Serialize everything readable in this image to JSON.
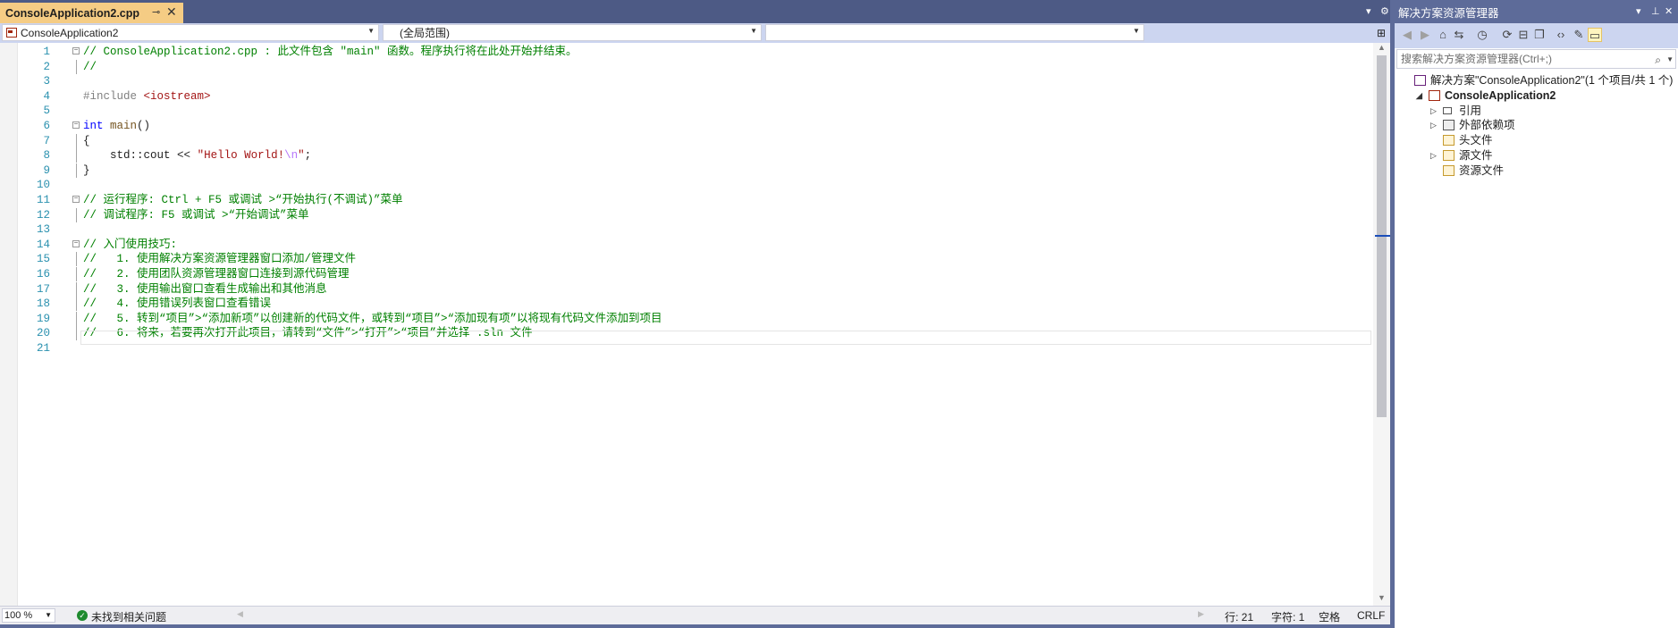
{
  "editor": {
    "tab": {
      "title": "ConsoleApplication2.cpp",
      "pin_glyph": "⊸",
      "close_glyph": "✕"
    },
    "navbar": {
      "project_combo": "ConsoleApplication2",
      "scope_combo": "(全局范围)",
      "member_combo": ""
    },
    "lines": [
      {
        "n": "1",
        "parts": [
          {
            "t": "// ConsoleApplication2.cpp : 此文件包含 \"main\" 函数。程序执行将在此处开始并结束。",
            "c": "cmt"
          }
        ],
        "fold": "−"
      },
      {
        "n": "2",
        "parts": [
          {
            "t": "//",
            "c": "cmt"
          }
        ],
        "guide": true
      },
      {
        "n": "3",
        "parts": []
      },
      {
        "n": "4",
        "parts": [
          {
            "t": "#include ",
            "c": "pp"
          },
          {
            "t": "<iostream>",
            "c": "inc"
          }
        ]
      },
      {
        "n": "5",
        "parts": []
      },
      {
        "n": "6",
        "parts": [
          {
            "t": "int",
            "c": "kw"
          },
          {
            "t": " ",
            "c": "id"
          },
          {
            "t": "main",
            "c": "fn"
          },
          {
            "t": "()",
            "c": "id"
          }
        ],
        "fold": "−"
      },
      {
        "n": "7",
        "parts": [
          {
            "t": "{",
            "c": "id"
          }
        ],
        "guide": true
      },
      {
        "n": "8",
        "parts": [
          {
            "t": "    std",
            "c": "id"
          },
          {
            "t": "::",
            "c": "id"
          },
          {
            "t": "cout ",
            "c": "id"
          },
          {
            "t": "<<",
            "c": "id"
          },
          {
            "t": " ",
            "c": "id"
          },
          {
            "t": "\"Hello World!",
            "c": "str"
          },
          {
            "t": "\\n",
            "c": "esc"
          },
          {
            "t": "\"",
            "c": "str"
          },
          {
            "t": ";",
            "c": "id"
          }
        ],
        "guide": true
      },
      {
        "n": "9",
        "parts": [
          {
            "t": "}",
            "c": "id"
          }
        ],
        "guide": true
      },
      {
        "n": "10",
        "parts": []
      },
      {
        "n": "11",
        "parts": [
          {
            "t": "// 运行程序: Ctrl + F5 或调试 >“开始执行(不调试)”菜单",
            "c": "cmt"
          }
        ],
        "fold": "−"
      },
      {
        "n": "12",
        "parts": [
          {
            "t": "// 调试程序: F5 或调试 >“开始调试”菜单",
            "c": "cmt"
          }
        ],
        "guide": true
      },
      {
        "n": "13",
        "parts": []
      },
      {
        "n": "14",
        "parts": [
          {
            "t": "// 入门使用技巧:",
            "c": "cmt"
          }
        ],
        "fold": "−"
      },
      {
        "n": "15",
        "parts": [
          {
            "t": "//   1. 使用解决方案资源管理器窗口添加/管理文件",
            "c": "cmt"
          }
        ],
        "guide": true
      },
      {
        "n": "16",
        "parts": [
          {
            "t": "//   2. 使用团队资源管理器窗口连接到源代码管理",
            "c": "cmt"
          }
        ],
        "guide": true
      },
      {
        "n": "17",
        "parts": [
          {
            "t": "//   3. 使用输出窗口查看生成输出和其他消息",
            "c": "cmt"
          }
        ],
        "guide": true
      },
      {
        "n": "18",
        "parts": [
          {
            "t": "//   4. 使用错误列表窗口查看错误",
            "c": "cmt"
          }
        ],
        "guide": true
      },
      {
        "n": "19",
        "parts": [
          {
            "t": "//   5. 转到“项目”>“添加新项”以创建新的代码文件，或转到“项目”>“添加现有项”以将现有代码文件添加到项目",
            "c": "cmt"
          }
        ],
        "guide": true
      },
      {
        "n": "20",
        "parts": [
          {
            "t": "//   6. 将来，若要再次打开此项目，请转到“文件”>“打开”>“项目”并选择 .sln 文件",
            "c": "cmt"
          }
        ],
        "guide": true
      },
      {
        "n": "21",
        "parts": []
      }
    ],
    "status": {
      "zoom": "100 %",
      "issues": "未找到相关问题",
      "line": "行: 21",
      "col": "字符: 1",
      "whitespace": "空格",
      "eol": "CRLF"
    }
  },
  "solution_explorer": {
    "title": "解决方案资源管理器",
    "search_placeholder": "搜索解决方案资源管理器(Ctrl+;)",
    "tree": [
      {
        "label": "解决方案\"ConsoleApplication2\"(1 个项目/共 1 个)",
        "icon": "solution-icon",
        "depth": 0,
        "expander": ""
      },
      {
        "label": "ConsoleApplication2",
        "icon": "cpp-project-icon",
        "depth": 1,
        "expander": "◢"
      },
      {
        "label": "引用",
        "icon": "references-icon",
        "depth": 2,
        "expander": "▷"
      },
      {
        "label": "外部依赖项",
        "icon": "external-deps-icon",
        "depth": 2,
        "expander": "▷"
      },
      {
        "label": "头文件",
        "icon": "filter-folder-icon",
        "depth": 2,
        "expander": ""
      },
      {
        "label": "源文件",
        "icon": "filter-folder-icon",
        "depth": 2,
        "expander": "▷"
      },
      {
        "label": "资源文件",
        "icon": "filter-folder-icon",
        "depth": 2,
        "expander": ""
      }
    ],
    "toolbar_icons": [
      "back-icon",
      "forward-icon",
      "home-icon",
      "switch-views-icon",
      "history-icon",
      "sync-icon",
      "collapse-all-icon",
      "show-all-files-icon",
      "view-code-icon",
      "properties-icon",
      "preview-icon"
    ]
  }
}
